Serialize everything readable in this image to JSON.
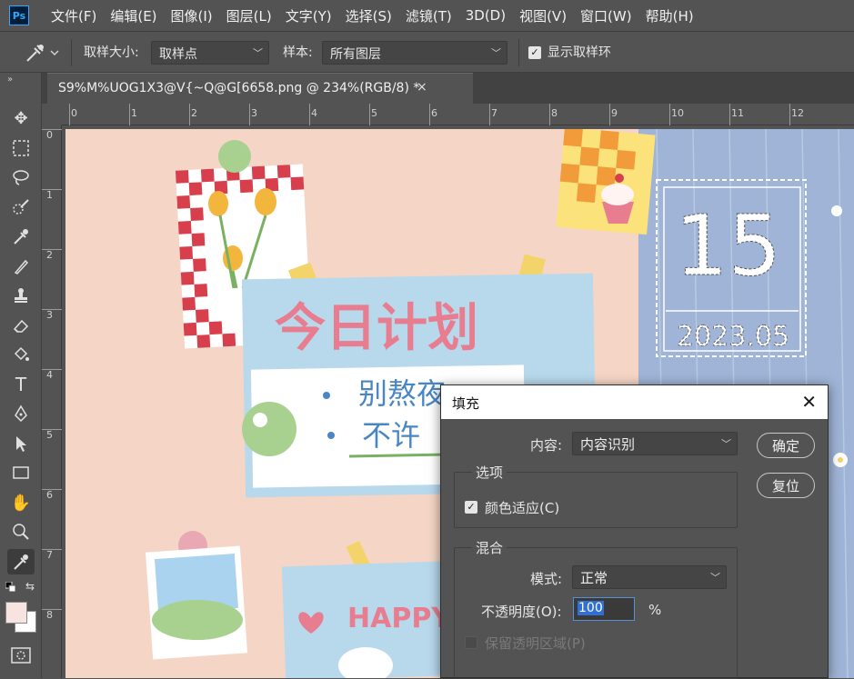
{
  "app": {
    "logo": "Ps"
  },
  "menubar": {
    "items": [
      "文件(F)",
      "编辑(E)",
      "图像(I)",
      "图层(L)",
      "文字(Y)",
      "选择(S)",
      "滤镜(T)",
      "3D(D)",
      "视图(V)",
      "窗口(W)",
      "帮助(H)"
    ]
  },
  "options": {
    "sample_size_label": "取样大小:",
    "sample_size_value": "取样点",
    "sample_label": "样本:",
    "sample_value": "所有图层",
    "show_ring_label": "显示取样环"
  },
  "document": {
    "tab_title": "S9%M%UOG1X3@V{~Q@G[6658.png @ 234%(RGB/8) *",
    "close_glyph": "×"
  },
  "ruler": {
    "h_labels": [
      "0",
      "1",
      "2",
      "3",
      "4",
      "5",
      "6",
      "7",
      "8",
      "9",
      "10",
      "11",
      "12"
    ],
    "v_labels": [
      "0",
      "1",
      "2",
      "3",
      "4",
      "5",
      "6",
      "7",
      "8"
    ]
  },
  "artwork": {
    "date_number": "15",
    "date_ym": "2023.05",
    "plan_title": "今日计划",
    "plan_line1": "别熬夜",
    "plan_line2": "不许",
    "happy": "HAPPY"
  },
  "dialog": {
    "title": "填充",
    "close_glyph": "✕",
    "content_label": "内容:",
    "content_value": "内容识别",
    "ok_button": "确定",
    "reset_button": "复位",
    "options_group": "选项",
    "color_adapt_label": "颜色适应(C)",
    "blend_group": "混合",
    "mode_label": "模式:",
    "mode_value": "正常",
    "opacity_label": "不透明度(O):",
    "opacity_value": "100",
    "opacity_unit": "%",
    "preserve_label": "保留透明区域(P)"
  },
  "colors": {
    "ui_bg": "#535353",
    "accent": "#31a8ff",
    "selection": "#2f6fd6"
  }
}
